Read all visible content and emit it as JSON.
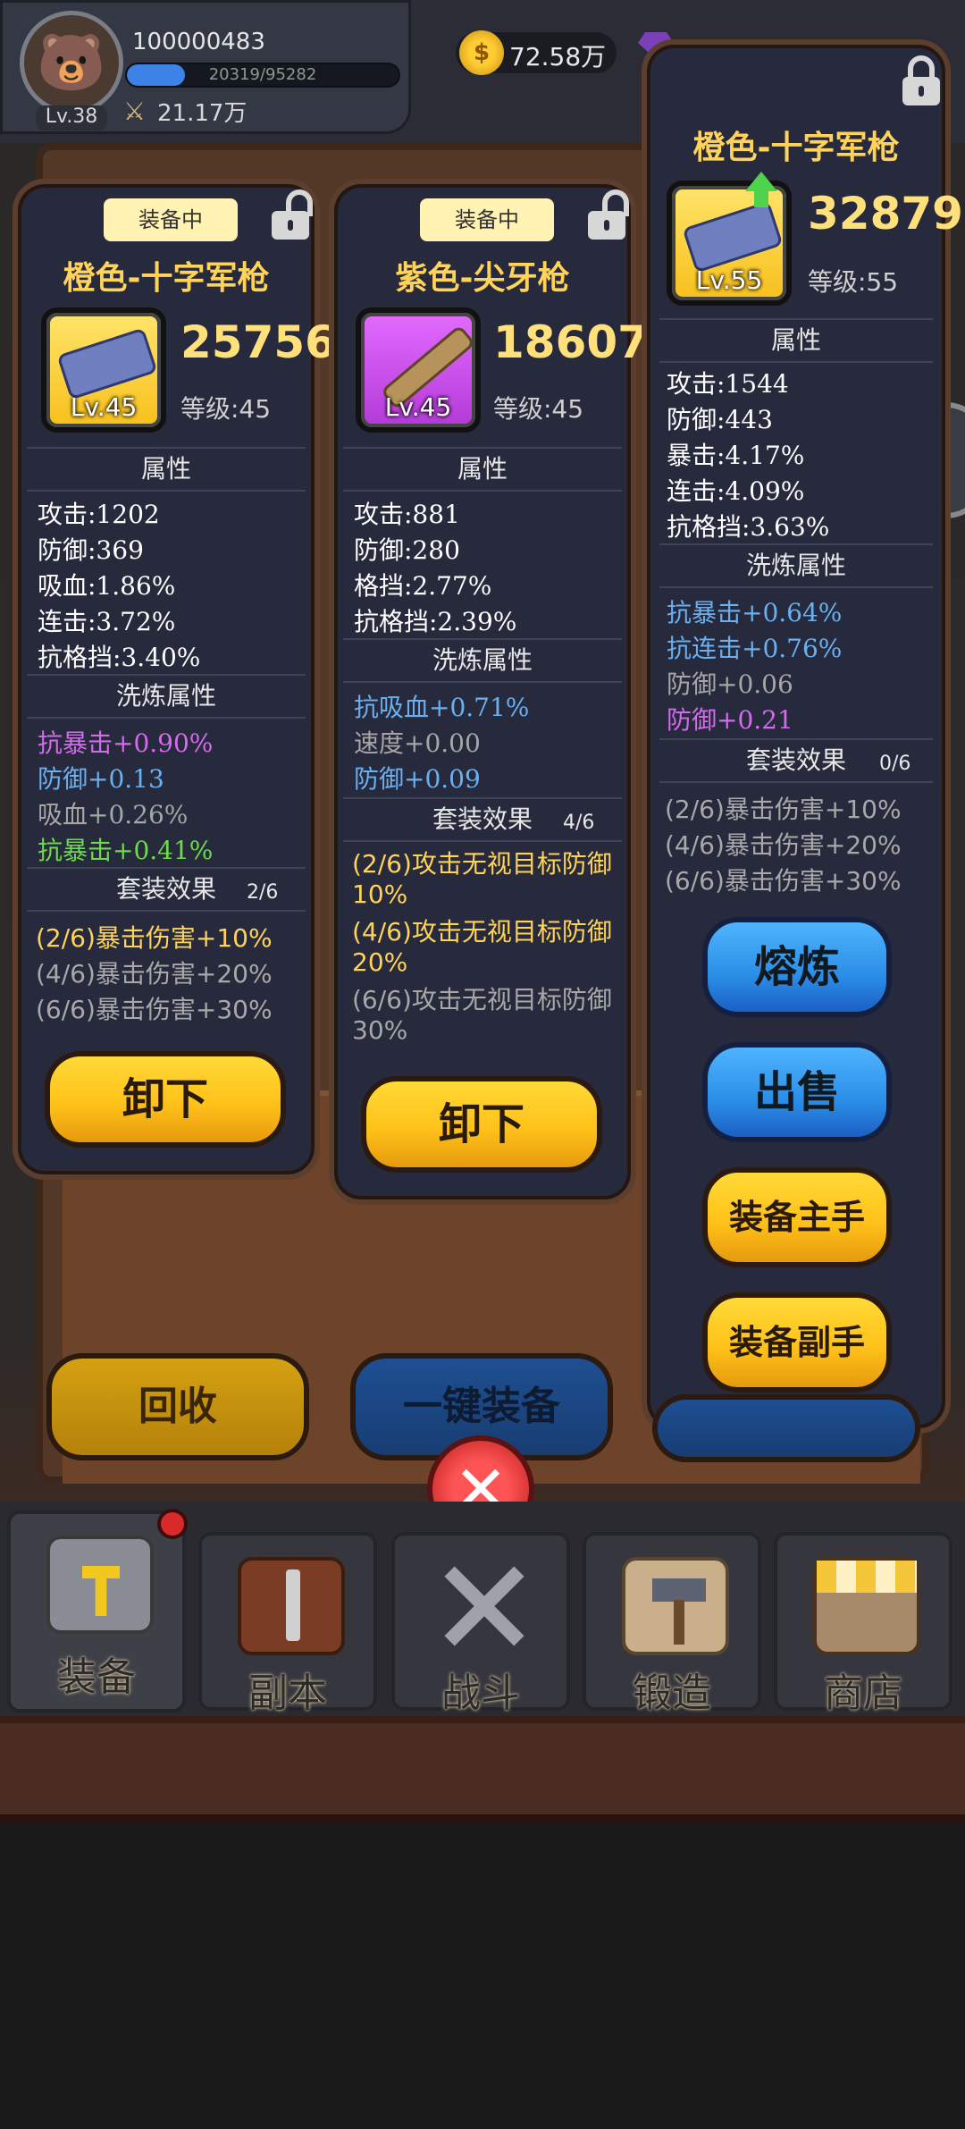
{
  "header": {
    "user_id": "100000483",
    "level": "Lv.38",
    "exp_text": "20319/95282",
    "exp_fraction": 0.213,
    "power": "21.17万",
    "gold": "72.58万",
    "avatar_icon": "bear-avatar-icon"
  },
  "cards": [
    {
      "equipped_tag": "装备中",
      "title": "橙色-十字军枪",
      "item_level": "Lv.45",
      "power": "25756",
      "level": "等级:45",
      "attr_head": "属性",
      "stats": [
        "攻击:1202",
        "防御:369",
        "吸血:1.86%",
        "连击:3.72%",
        "抗格挡:3.40%"
      ],
      "refine_head": "洗炼属性",
      "refine": [
        {
          "text": "抗暴击+0.90%",
          "color": "purple"
        },
        {
          "text": "防御+0.13",
          "color": "blue"
        },
        {
          "text": "吸血+0.26%",
          "color": "grey"
        },
        {
          "text": "抗暴击+0.41%",
          "color": "green"
        }
      ],
      "set_head": "套装效果",
      "set_count": "2/6",
      "set_effects": [
        {
          "text": "(2/6)暴击伤害+10%",
          "active": true
        },
        {
          "text": "(4/6)暴击伤害+20%",
          "active": false
        },
        {
          "text": "(6/6)暴击伤害+30%",
          "active": false
        }
      ],
      "button": "卸下"
    },
    {
      "equipped_tag": "装备中",
      "title": "紫色-尖牙枪",
      "item_level": "Lv.45",
      "power": "18607",
      "level": "等级:45",
      "attr_head": "属性",
      "stats": [
        "攻击:881",
        "防御:280",
        "格挡:2.77%",
        "抗格挡:2.39%"
      ],
      "refine_head": "洗炼属性",
      "refine": [
        {
          "text": "抗吸血+0.71%",
          "color": "blue"
        },
        {
          "text": "速度+0.00",
          "color": "grey"
        },
        {
          "text": "防御+0.09",
          "color": "blue"
        }
      ],
      "set_head": "套装效果",
      "set_count": "4/6",
      "set_effects": [
        {
          "text": "(2/6)攻击无视目标防御10%",
          "active": true
        },
        {
          "text": "(4/6)攻击无视目标防御20%",
          "active": true
        },
        {
          "text": "(6/6)攻击无视目标防御30%",
          "active": false
        }
      ],
      "button": "卸下"
    },
    {
      "title": "橙色-十字军枪",
      "item_level": "Lv.55",
      "power": "32879",
      "level": "等级:55",
      "attr_head": "属性",
      "stats": [
        "攻击:1544",
        "防御:443",
        "暴击:4.17%",
        "连击:4.09%",
        "抗格挡:3.63%"
      ],
      "refine_head": "洗炼属性",
      "refine": [
        {
          "text": "抗暴击+0.64%",
          "color": "blue"
        },
        {
          "text": "抗连击+0.76%",
          "color": "blue"
        },
        {
          "text": "防御+0.06",
          "color": "grey"
        },
        {
          "text": "防御+0.21",
          "color": "purple"
        }
      ],
      "set_head": "套装效果",
      "set_count": "0/6",
      "set_effects": [
        {
          "text": "(2/6)暴击伤害+10%",
          "active": false
        },
        {
          "text": "(4/6)暴击伤害+20%",
          "active": false
        },
        {
          "text": "(6/6)暴击伤害+30%",
          "active": false
        }
      ],
      "buttons": [
        "熔炼",
        "出售",
        "装备主手",
        "装备副手"
      ]
    }
  ],
  "bottom_buttons": {
    "recycle": "回收",
    "auto_equip": "一键装备"
  },
  "nav": [
    {
      "label": "装备",
      "icon": "helmet-icon"
    },
    {
      "label": "副本",
      "icon": "sword-shield-icon"
    },
    {
      "label": "战斗",
      "icon": "crossed-swords-icon"
    },
    {
      "label": "锻造",
      "icon": "hammer-scroll-icon"
    },
    {
      "label": "商店",
      "icon": "shop-icon"
    }
  ],
  "colors": {
    "title": "#ffd35a",
    "panel": "#262a3c",
    "stat_blue": "#6ab0f0",
    "stat_purple": "#d46aec",
    "stat_green": "#6cdc4c"
  }
}
